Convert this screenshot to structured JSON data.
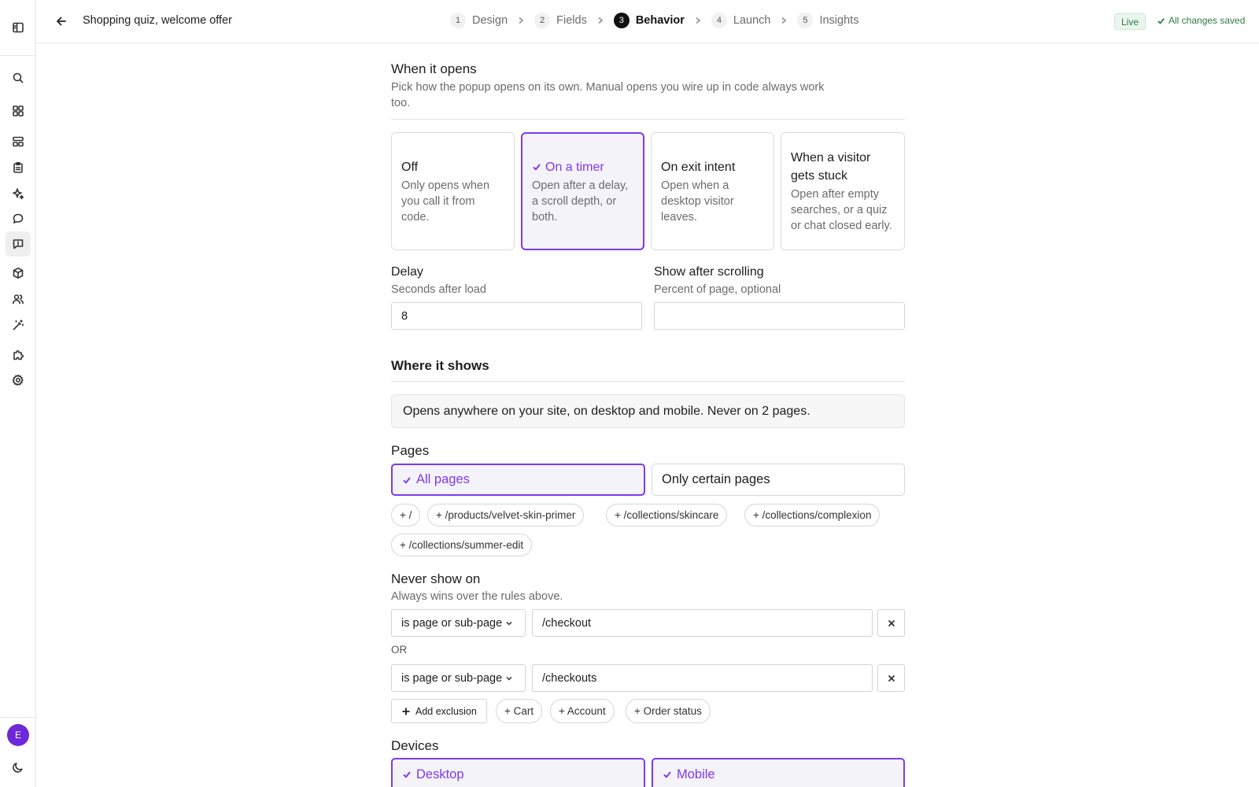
{
  "header": {
    "title": "Shopping quiz, welcome offer",
    "steps": [
      {
        "num": "1",
        "label": "Design"
      },
      {
        "num": "2",
        "label": "Fields"
      },
      {
        "num": "3",
        "label": "Behavior"
      },
      {
        "num": "4",
        "label": "Launch"
      },
      {
        "num": "5",
        "label": "Insights"
      }
    ],
    "active_step": "Behavior",
    "status_badge": "Live",
    "save_status": "All changes saved"
  },
  "sidebar": {
    "icons": [
      "panel-toggle-icon",
      "search-icon",
      "dashboard-icon",
      "layout-icon",
      "clipboard-icon",
      "sparkles-icon",
      "chat-bubble-icon",
      "message-square-icon",
      "box-icon",
      "users-icon",
      "magic-wand-icon",
      "puzzle-icon",
      "gear-icon",
      "moon-icon"
    ],
    "active_icon": "message-square-icon",
    "avatar_initial": "E",
    "accent": "#6d28d9"
  },
  "when_opens": {
    "title": "When it opens",
    "description": "Pick how the popup opens on its own. Manual opens you wire up in code always work too.",
    "options": [
      {
        "title": "Off",
        "desc": "Only opens when you call it from code.",
        "selected": false
      },
      {
        "title": "On a timer",
        "desc": "Open after a delay, a scroll depth, or both.",
        "selected": true
      },
      {
        "title": "On exit intent",
        "desc": "Open when a desktop visitor leaves.",
        "selected": false
      },
      {
        "title": "When a visitor gets stuck",
        "desc": "Open after empty searches, or a quiz or chat closed early.",
        "selected": false
      }
    ],
    "delay_label": "Delay",
    "delay_sub": "Seconds after load",
    "delay_value": "8",
    "scroll_label": "Show after scrolling",
    "scroll_sub": "Percent of page, optional",
    "scroll_value": ""
  },
  "where_shows": {
    "title": "Where it shows",
    "summary": "Opens anywhere on your site, on desktop and mobile. Never on 2 pages.",
    "pages_label": "Pages",
    "pages_options": [
      {
        "label": "All pages",
        "selected": true
      },
      {
        "label": "Only certain pages",
        "selected": false
      }
    ],
    "page_chips": [
      "+ /",
      "+ /products/velvet-skin-primer",
      "+ /collections/skincare",
      "+ /collections/complexion",
      "+ /collections/summer-edit"
    ],
    "never_label": "Never show on",
    "never_sub": "Always wins over the rules above.",
    "exclusions": [
      {
        "operator": "is page or sub-page",
        "value": "/checkout"
      },
      {
        "operator": "is page or sub-page",
        "value": "/checkouts"
      }
    ],
    "or_label": "OR",
    "add_exclusion_label": "Add exclusion",
    "exclusion_chips": [
      "+ Cart",
      "+ Account",
      "+ Order status"
    ],
    "devices_label": "Devices",
    "devices": [
      {
        "label": "Desktop",
        "selected": true
      },
      {
        "label": "Mobile",
        "selected": true
      }
    ]
  },
  "colors": {
    "accent": "#7c3aed",
    "live_green": "#2f7a46"
  }
}
